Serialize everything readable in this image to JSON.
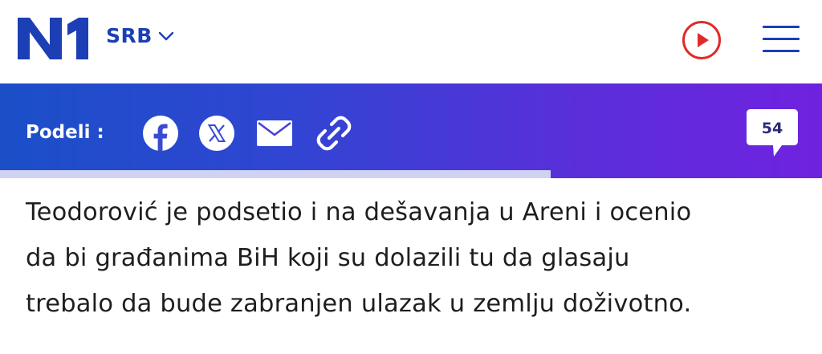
{
  "header": {
    "logo_text": "N1",
    "language": "SRB",
    "icons": {
      "language_dropdown": "chevron-down-icon",
      "live": "play-circle-icon",
      "menu": "hamburger-menu-icon"
    },
    "colors": {
      "brand_blue": "#1c3fb6",
      "live_red": "#e02a2a"
    }
  },
  "share": {
    "label": "Podeli :",
    "icons": [
      "facebook-icon",
      "x-icon",
      "mail-icon",
      "link-icon"
    ],
    "comment_count": "54",
    "gradient": [
      "#1b4fc8",
      "#6f22df"
    ],
    "reading_progress": 0.67
  },
  "article": {
    "lines": [
      "Teodorović je podsetio i na dešavanja u Areni i ocenio",
      "da bi građanima BiH koji su dolazili tu da glasaju",
      "trebalo da bude zabranjen ulazak u zemlju doživotno."
    ]
  }
}
